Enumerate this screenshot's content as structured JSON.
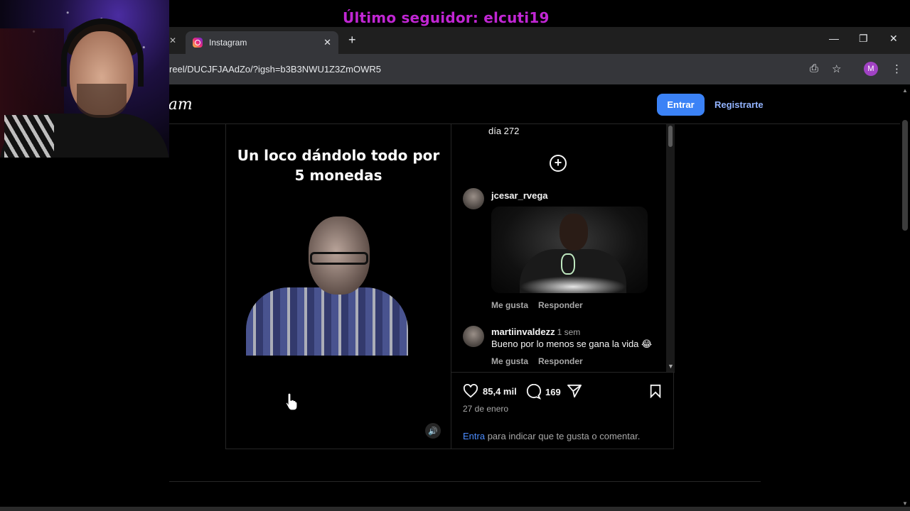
{
  "stream": {
    "banner": "Último seguidor: elcuti19"
  },
  "browser": {
    "tab_title": "Instagram",
    "url": "reel/DUCJFJAAdZo/?igsh=b3B3NWU1Z3ZmOWR5",
    "profile_initial": "M"
  },
  "header": {
    "logo_text": "Instagram",
    "login_label": "Entrar",
    "signup_label": "Registrarte"
  },
  "video": {
    "caption_line1": "Un loco dándolo todo por",
    "caption_line2": "5 monedas"
  },
  "comments": {
    "top_text": "día 272",
    "items": [
      {
        "user": "jcesar_rvega",
        "time": "",
        "text": "",
        "like_label": "Me gusta",
        "reply_label": "Responder"
      },
      {
        "user": "martiinvaldezz",
        "time": "1 sem",
        "text": "Bueno por lo menos se gana la vida 😂",
        "like_label": "Me gusta",
        "reply_label": "Responder"
      }
    ]
  },
  "post_actions": {
    "likes": "85,4 mil",
    "comments": "169",
    "date": "27 de enero",
    "login_link": "Entra",
    "login_note": " para indicar que te gusta o comentar."
  },
  "colors": {
    "accent_blue": "#3b82f6",
    "link_blue": "#4c8dff",
    "banner_magenta": "#c026d3"
  }
}
